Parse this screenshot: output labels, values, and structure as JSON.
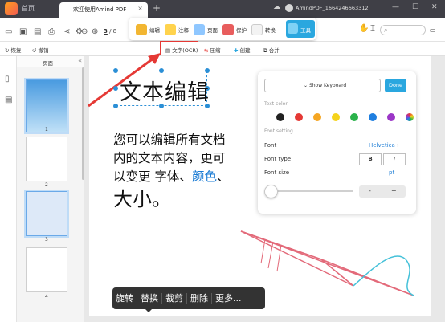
{
  "titlebar": {
    "home_label": "首页",
    "tab_label": "欢迎使用Amind PDF",
    "user": "AmindPDF_1664246663312"
  },
  "toolbar": {
    "page_current": "3",
    "page_total": "/ 8"
  },
  "palette": {
    "items": [
      "编辑",
      "注释",
      "页面",
      "保护",
      "转换",
      "工具"
    ]
  },
  "toolbar2": {
    "undo": "恢复",
    "redo": "撤销",
    "text_ocr": "文字(OCR)",
    "compress": "压缩",
    "create": "创建",
    "merge": "合并"
  },
  "thumbs": {
    "header": "页面",
    "pages": [
      "1",
      "2",
      "3",
      "4"
    ]
  },
  "document": {
    "title": "文本编辑",
    "body_line1": "您可以编辑所有文档",
    "body_line2": "内的文本内容，更可",
    "body_line3a": "以变更 字体、",
    "body_line3b": "颜色",
    "body_line3c": "、",
    "body_line4": "大小。"
  },
  "keyboard_panel": {
    "select_label": "Show Keyboard",
    "done": "Done",
    "text_color": "Text color",
    "font_setting": "Font setting",
    "font": "Font",
    "font_value": "Helvetica",
    "font_type": "Font type",
    "bold": "B",
    "italic": "I",
    "font_size": "Font size",
    "font_size_unit": "pt",
    "minus": "-",
    "plus": "+",
    "colors": [
      "#222222",
      "#e53935",
      "#f5a623",
      "#f5d31c",
      "#2ab24a",
      "#1f7fe0",
      "#9b36c7"
    ]
  },
  "context_menu": {
    "items": [
      "旋转",
      "替换",
      "裁剪",
      "删除",
      "更多..."
    ]
  }
}
